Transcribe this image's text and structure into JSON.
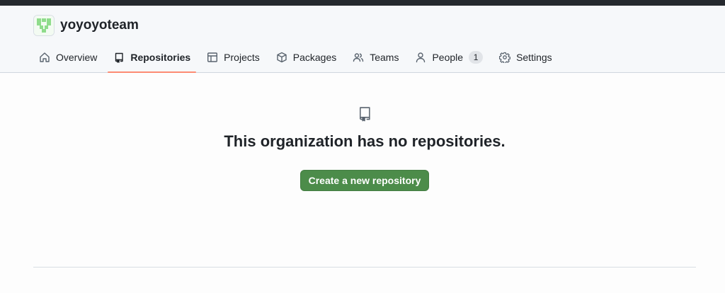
{
  "org": {
    "name": "yoyoyoteam"
  },
  "tabs": [
    {
      "label": "Overview",
      "icon": "home-icon"
    },
    {
      "label": "Repositories",
      "icon": "repo-icon",
      "selected": true
    },
    {
      "label": "Projects",
      "icon": "table-icon"
    },
    {
      "label": "Packages",
      "icon": "package-icon"
    },
    {
      "label": "Teams",
      "icon": "people-icon"
    },
    {
      "label": "People",
      "icon": "person-icon",
      "count": "1"
    },
    {
      "label": "Settings",
      "icon": "gear-icon"
    }
  ],
  "empty_state": {
    "icon": "repo-icon",
    "title": "This organization has no repositories.",
    "button_label": "Create a new repository"
  },
  "colors": {
    "selected_tab_underline": "#fd8c73",
    "primary_button": "#4c8c4a",
    "avatar_accent": "#8fdc8b"
  }
}
